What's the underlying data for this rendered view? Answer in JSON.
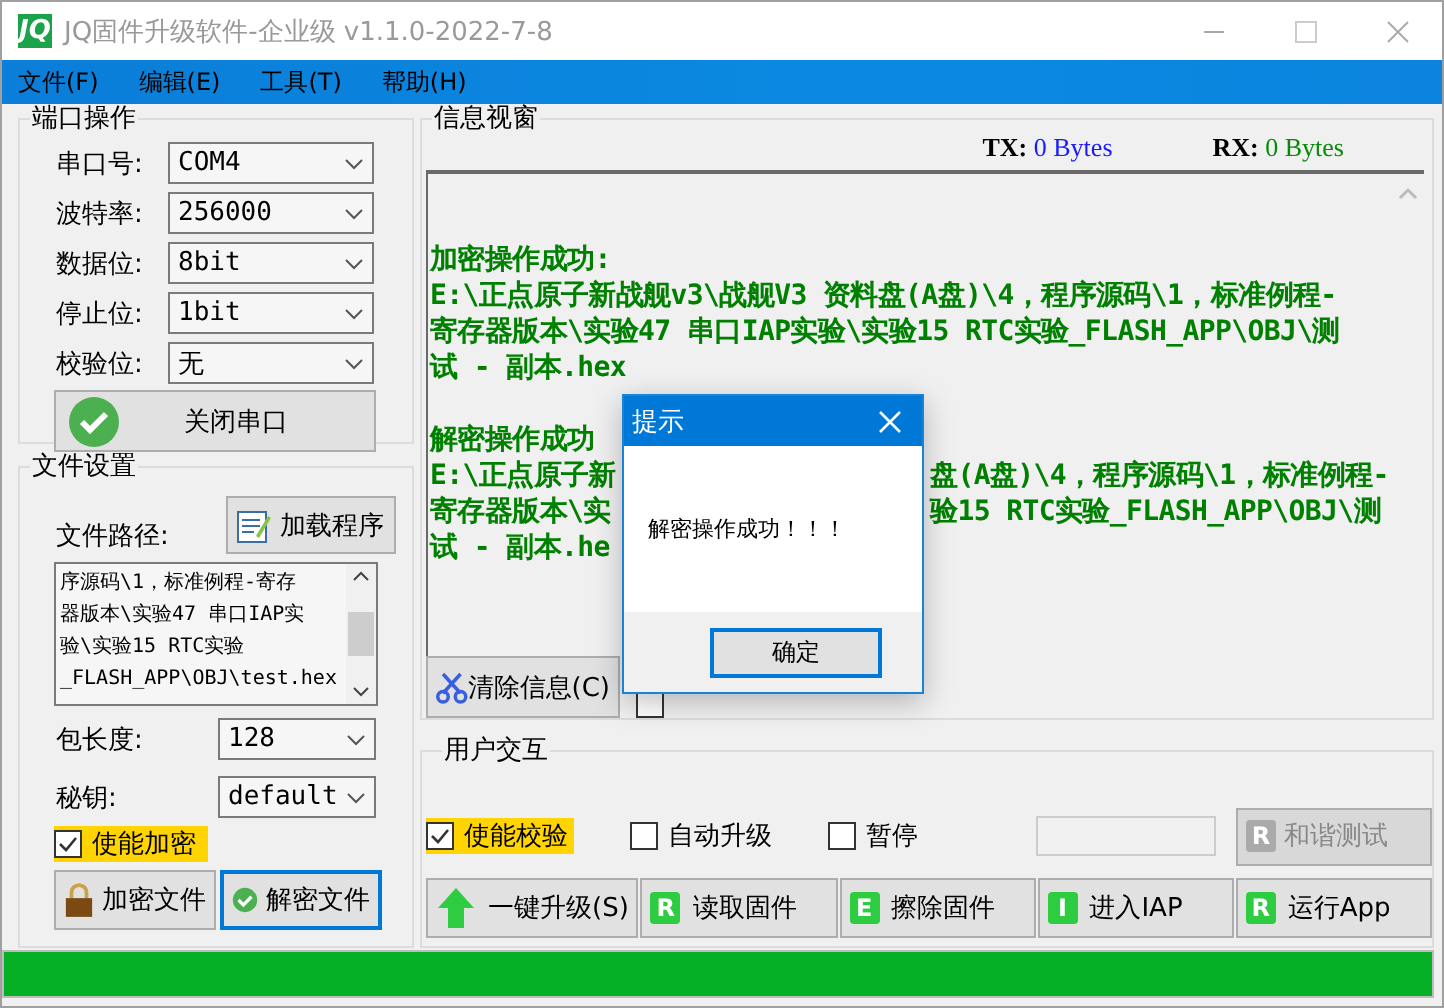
{
  "window": {
    "logo": "JQ",
    "title": "JQ固件升级软件-企业级 v1.1.0-2022-7-8"
  },
  "menu": [
    "文件(F)",
    "编辑(E)",
    "工具(T)",
    "帮助(H)"
  ],
  "port_group": {
    "title": "端口操作",
    "fields": [
      {
        "label": "串口号:",
        "value": "COM4"
      },
      {
        "label": "波特率:",
        "value": "256000"
      },
      {
        "label": "数据位:",
        "value": "8bit"
      },
      {
        "label": "停止位:",
        "value": "1bit"
      },
      {
        "label": "校验位:",
        "value": "无"
      }
    ],
    "button": "关闭串口"
  },
  "file_group": {
    "title": "文件设置",
    "path_label": "文件路径:",
    "load_button": "加载程序",
    "path_lines": [
      "序源码\\1，标准例程-寄存",
      "器版本\\实验47 串口IAP实",
      "验\\实验15 RTC实验",
      "_FLASH_APP\\OBJ\\test.hex"
    ],
    "fields": [
      {
        "label": "包长度:",
        "value": "128"
      },
      {
        "label": "秘钥:",
        "value": "default"
      }
    ],
    "encrypt_checkbox": {
      "label": "使能加密",
      "checked": true
    },
    "buttons": [
      {
        "label": "加密文件",
        "kind": "lock",
        "focused": false
      },
      {
        "label": "解密文件",
        "kind": "check",
        "focused": true
      }
    ]
  },
  "info_group": {
    "title": "信息视窗",
    "tx_label": "TX:",
    "tx_value": "0 Bytes",
    "rx_label": "RX:",
    "rx_value": "0 Bytes",
    "log": [
      {
        "lines": [
          {
            "text": "加密操作成功:"
          },
          {
            "text": "E:\\正点原子新战舰v3\\战舰V3 资料盘(A盘)\\4，程序源码\\1，标准例程-"
          },
          {
            "text": "寄存器版本\\实验47 串口IAP实验\\实验15 RTC实验_FLASH_APP\\OBJ\\测"
          },
          {
            "text": "试 - 副本.hex"
          }
        ]
      },
      {
        "lines": [
          {
            "text": "解密操作成功"
          },
          {
            "text": "E:\\正点原子新",
            "after_cover": "盘(A盘)\\4，程序源码\\1，标准例程-"
          },
          {
            "text": "寄存器版本\\实",
            "after_cover": "验15 RTC实验_FLASH_APP\\OBJ\\测"
          },
          {
            "text": "试 - 副本.he"
          }
        ]
      }
    ],
    "clear_button": "清除信息(C)",
    "show_transfer_checkbox": {
      "checked": false
    }
  },
  "user_group": {
    "title": "用户交互",
    "checkboxes": [
      {
        "label": "使能校验",
        "checked": true
      },
      {
        "label": "自动升级",
        "checked": false
      },
      {
        "label": "暂停",
        "checked": false
      }
    ],
    "test_button": {
      "label": "和谐测试",
      "badge": "R",
      "disabled": true
    },
    "actions": [
      {
        "label": "一键升级(S)",
        "kind": "arrow"
      },
      {
        "label": "读取固件",
        "kind": "letter",
        "badge": "R"
      },
      {
        "label": "擦除固件",
        "kind": "letter",
        "badge": "E"
      },
      {
        "label": "进入IAP",
        "kind": "letter",
        "badge": "I"
      },
      {
        "label": "运行App",
        "kind": "letter",
        "badge": "R"
      }
    ]
  },
  "progress": {
    "level": 1
  },
  "dialog": {
    "title": "提示",
    "message": "解密操作成功！！！",
    "button": "确定"
  }
}
